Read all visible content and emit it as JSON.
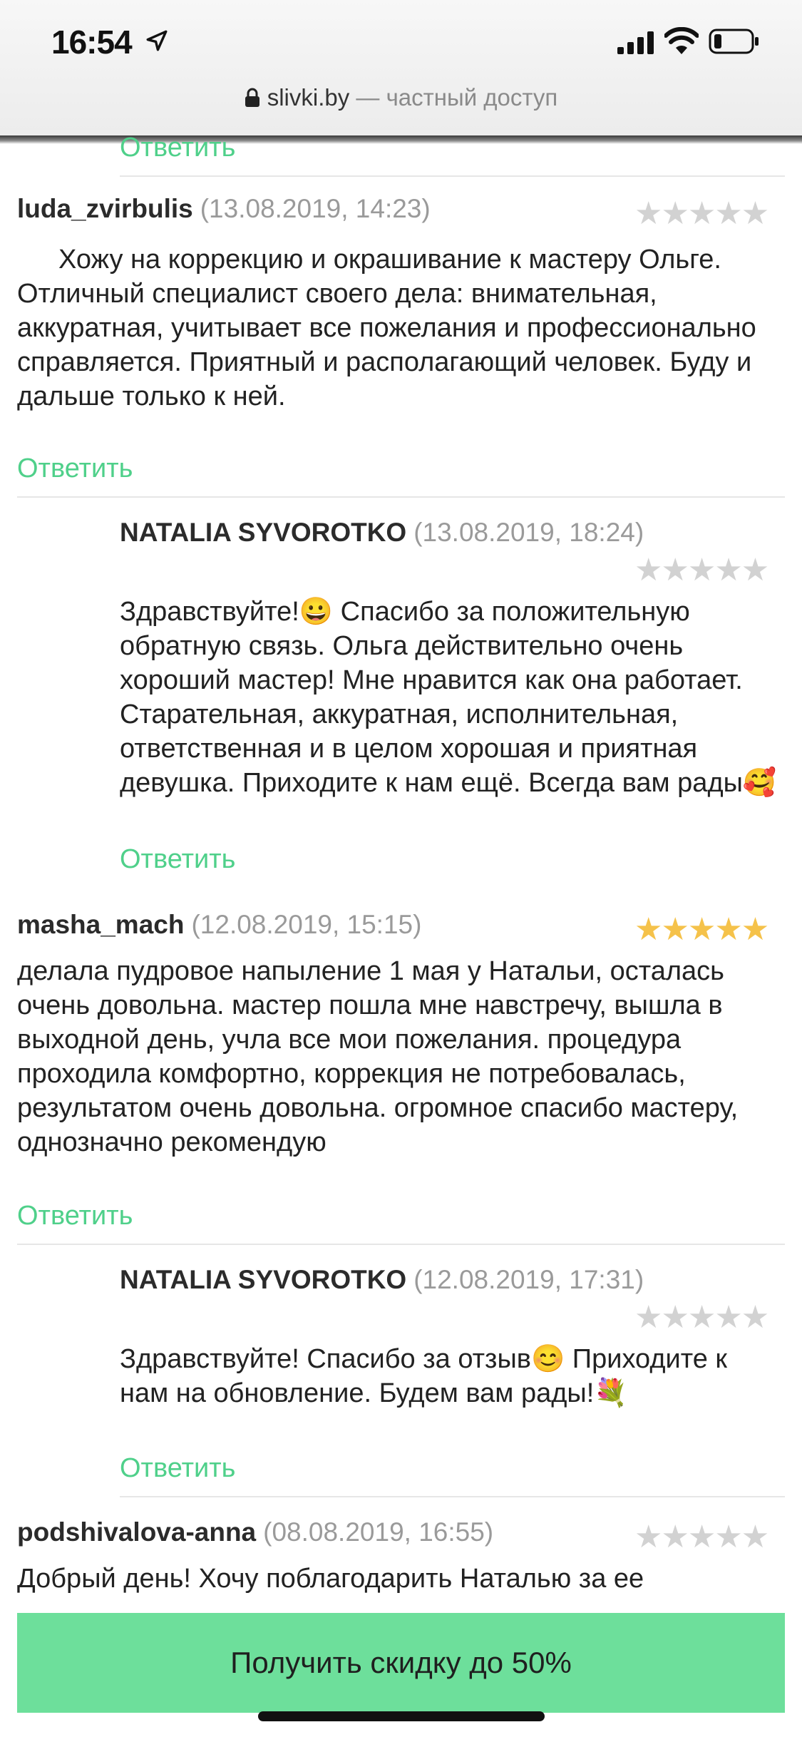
{
  "status_bar": {
    "time": "16:54"
  },
  "address_bar": {
    "domain": "slivki.by",
    "separator": " — ",
    "suffix": "частный доступ"
  },
  "reply_label": "Ответить",
  "reviews": [
    {
      "author": "luda_zvirbulis",
      "date": "(13.08.2019, 14:23)",
      "stars_filled": 0,
      "text": "Хожу на коррекцию и окрашивание к мастеру Ольге. Отличный специалист своего дела: внимательная, аккуратная, учитывает все пожелания и профессионально справляется. Приятный и располагающий  человек. Буду и дальше только к ней.",
      "reply": {
        "author": "NATALIA SYVOROTKO",
        "date": "(13.08.2019, 18:24)",
        "stars_filled": 0,
        "text": "Здравствуйте!😀 Спасибо за положительную обратную связь. Ольга действительно очень хороший мастер! Мне нравится как она работает. Старательная, аккуратная, исполнительная, ответственная и в целом хорошая и приятная девушка. Приходите к нам ещё. Всегда вам рады🥰"
      }
    },
    {
      "author": "masha_mach",
      "date": "(12.08.2019, 15:15)",
      "stars_filled": 5,
      "text": "делала пудровое напыление 1 мая у Натальи, осталась очень довольна. мастер пошла мне навстречу, вышла в выходной день, учла все мои пожелания. процедура проходила комфортно, коррекция не потребовалась, результатом очень довольна. огромное спасибо мастеру, однозначно рекомендую",
      "reply": {
        "author": "NATALIA SYVOROTKO",
        "date": "(12.08.2019, 17:31)",
        "stars_filled": 0,
        "text": "Здравствуйте! Спасибо за отзыв😊 Приходите к нам на обновление. Будем вам рады!💐"
      }
    },
    {
      "author": "podshivalova-anna",
      "date": "(08.08.2019, 16:55)",
      "stars_filled": 0,
      "text": "Добрый день! Хочу поблагодарить Наталью за ее"
    }
  ],
  "stars_glyphs": "★★★★★",
  "cta": {
    "label": "Получить скидку до 50%"
  },
  "colors": {
    "accent": "#4fd08a",
    "cta_bg": "#6ddf9b",
    "star_gold": "#f5c24a",
    "star_grey": "#d2d2d2"
  }
}
